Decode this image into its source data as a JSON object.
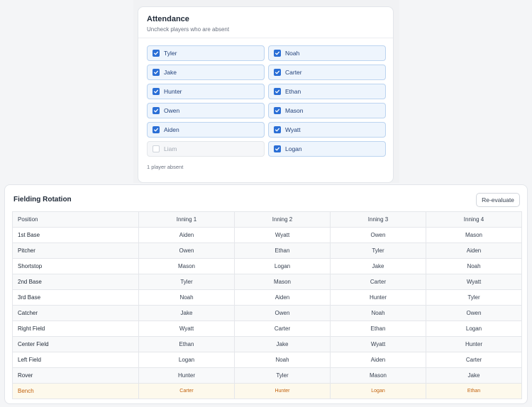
{
  "attendance": {
    "title": "Attendance",
    "subtitle": "Uncheck players who are absent",
    "players": [
      {
        "name": "Tyler",
        "present": true
      },
      {
        "name": "Noah",
        "present": true
      },
      {
        "name": "Jake",
        "present": true
      },
      {
        "name": "Carter",
        "present": true
      },
      {
        "name": "Hunter",
        "present": true
      },
      {
        "name": "Ethan",
        "present": true
      },
      {
        "name": "Owen",
        "present": true
      },
      {
        "name": "Mason",
        "present": true
      },
      {
        "name": "Aiden",
        "present": true
      },
      {
        "name": "Wyatt",
        "present": true
      },
      {
        "name": "Liam",
        "present": false
      },
      {
        "name": "Logan",
        "present": true
      }
    ],
    "footer": "1 player absent"
  },
  "rotation": {
    "title": "Fielding Rotation",
    "button_label": "Re-evaluate",
    "columns": [
      "Position",
      "Inning 1",
      "Inning 2",
      "Inning 3",
      "Inning 4"
    ],
    "rows": [
      {
        "position": "1st Base",
        "innings": [
          "Aiden",
          "Wyatt",
          "Owen",
          "Mason"
        ]
      },
      {
        "position": "Pitcher",
        "innings": [
          "Owen",
          "Ethan",
          "Tyler",
          "Aiden"
        ]
      },
      {
        "position": "Shortstop",
        "innings": [
          "Mason",
          "Logan",
          "Jake",
          "Noah"
        ]
      },
      {
        "position": "2nd Base",
        "innings": [
          "Tyler",
          "Mason",
          "Carter",
          "Wyatt"
        ]
      },
      {
        "position": "3rd Base",
        "innings": [
          "Noah",
          "Aiden",
          "Hunter",
          "Tyler"
        ]
      },
      {
        "position": "Catcher",
        "innings": [
          "Jake",
          "Owen",
          "Noah",
          "Owen"
        ]
      },
      {
        "position": "Right Field",
        "innings": [
          "Wyatt",
          "Carter",
          "Ethan",
          "Logan"
        ]
      },
      {
        "position": "Center Field",
        "innings": [
          "Ethan",
          "Jake",
          "Wyatt",
          "Hunter"
        ]
      },
      {
        "position": "Left Field",
        "innings": [
          "Logan",
          "Noah",
          "Aiden",
          "Carter"
        ]
      },
      {
        "position": "Rover",
        "innings": [
          "Hunter",
          "Tyler",
          "Mason",
          "Jake"
        ]
      },
      {
        "position": "Bench",
        "innings": [
          "Carter",
          "Hunter",
          "Logan",
          "Ethan"
        ],
        "bench": true
      }
    ]
  },
  "colors": {
    "accent": "#2b6fd6",
    "bench_text": "#c2610c",
    "bench_bg": "#fdf9ec"
  }
}
